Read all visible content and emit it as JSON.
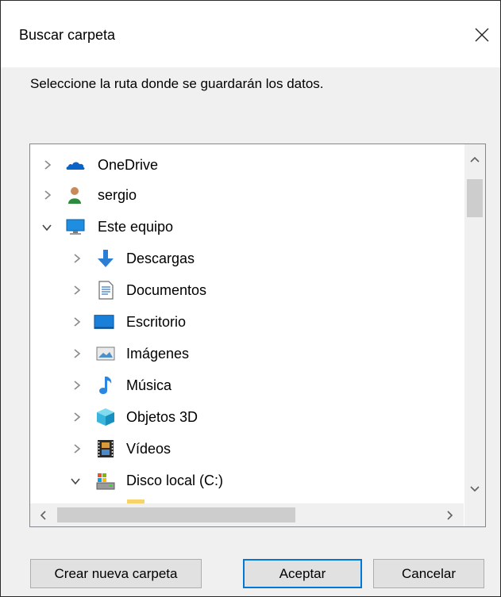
{
  "dialog": {
    "title": "Buscar carpeta",
    "prompt": "Seleccione la ruta donde se guardarán los datos."
  },
  "tree": {
    "items": [
      {
        "label": "OneDrive",
        "icon": "onedrive-cloud-icon",
        "expanded": false,
        "level": 0
      },
      {
        "label": "sergio",
        "icon": "user-icon",
        "expanded": false,
        "level": 0
      },
      {
        "label": "Este equipo",
        "icon": "computer-icon",
        "expanded": true,
        "level": 0
      },
      {
        "label": "Descargas",
        "icon": "download-arrow-icon",
        "expanded": false,
        "level": 1
      },
      {
        "label": "Documentos",
        "icon": "document-icon",
        "expanded": false,
        "level": 1
      },
      {
        "label": "Escritorio",
        "icon": "desktop-icon",
        "expanded": false,
        "level": 1
      },
      {
        "label": "Imágenes",
        "icon": "pictures-icon",
        "expanded": false,
        "level": 1
      },
      {
        "label": "Música",
        "icon": "music-note-icon",
        "expanded": false,
        "level": 1
      },
      {
        "label": "Objetos 3D",
        "icon": "cube-3d-icon",
        "expanded": false,
        "level": 1
      },
      {
        "label": "Vídeos",
        "icon": "film-icon",
        "expanded": false,
        "level": 1
      },
      {
        "label": "Disco local (C:)",
        "icon": "local-disk-icon",
        "expanded": true,
        "level": 1
      }
    ]
  },
  "buttons": {
    "new_folder": "Crear nueva carpeta",
    "accept": "Aceptar",
    "cancel": "Cancelar"
  },
  "colors": {
    "accent": "#0078d7",
    "dialog_bg": "#f0f0f0"
  }
}
